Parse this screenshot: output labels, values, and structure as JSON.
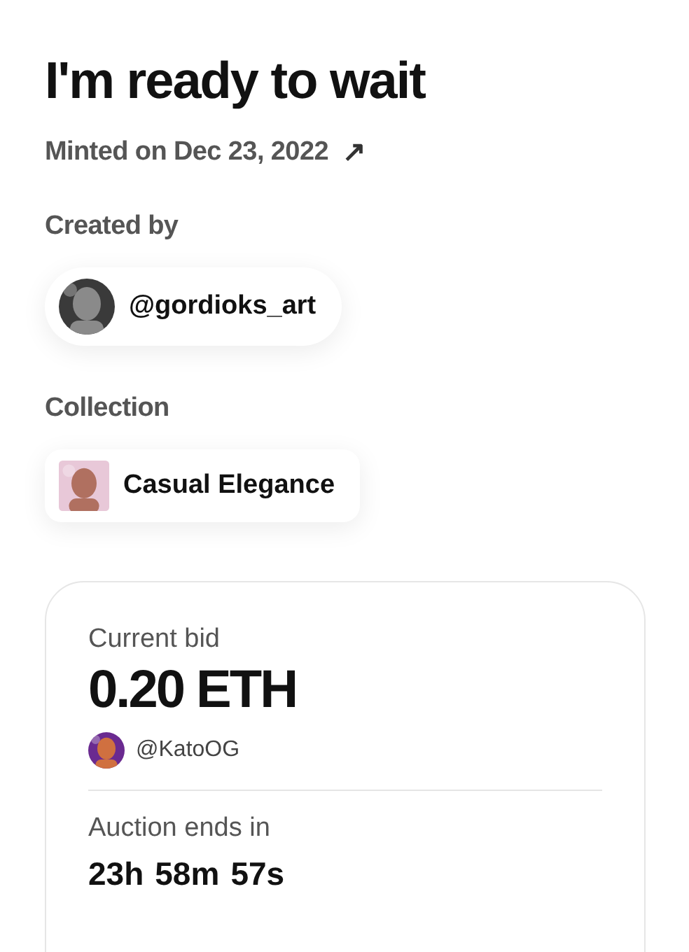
{
  "title": "I'm ready to wait",
  "minted": {
    "label": "Minted on Dec 23, 2022",
    "link_icon": "↗"
  },
  "creator": {
    "label": "Created by",
    "handle": "@gordioks_art"
  },
  "collection": {
    "label": "Collection",
    "name": "Casual Elegance"
  },
  "auction": {
    "bid_label": "Current bid",
    "bid": "0.20 ETH",
    "bidder": "@KatoOG",
    "ends_label": "Auction ends in",
    "countdown": [
      "23h",
      "58m",
      "57s"
    ]
  }
}
